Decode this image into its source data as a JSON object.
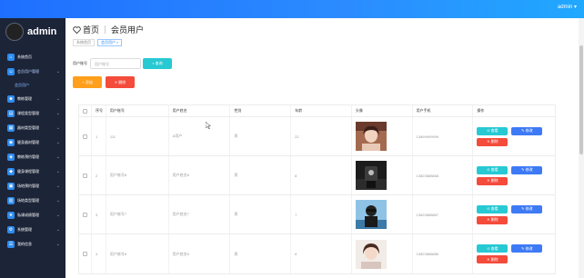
{
  "topbar": {
    "user": "admin ▾"
  },
  "brand": {
    "name": "admin"
  },
  "sidebar": {
    "items": [
      {
        "label": "系统首页",
        "caret": "",
        "icon": "⌂"
      },
      {
        "label": "会员用户管理",
        "caret": "⌄",
        "icon": "☺",
        "active": true
      },
      {
        "label": "会员用户",
        "sub": true
      },
      {
        "label": "教练管理",
        "caret": "⌄",
        "icon": "☻"
      },
      {
        "label": "课程类型管理",
        "caret": "⌄",
        "icon": "▤"
      },
      {
        "label": "器材类型管理",
        "caret": "⌄",
        "icon": "▦"
      },
      {
        "label": "健身器材管理",
        "caret": "⌄",
        "icon": "◉"
      },
      {
        "label": "教练预约管理",
        "caret": "⌄",
        "icon": "◈"
      },
      {
        "label": "健身课程管理",
        "caret": "⌄",
        "icon": "◆"
      },
      {
        "label": "场地预约管理",
        "caret": "⌄",
        "icon": "▣"
      },
      {
        "label": "场地类型管理",
        "caret": "⌄",
        "icon": "▥"
      },
      {
        "label": "私课成绩管理",
        "caret": "⌄",
        "icon": "★"
      },
      {
        "label": "系统管理",
        "caret": "⌄",
        "icon": "⚙"
      },
      {
        "label": "我的信息",
        "caret": "⌄",
        "icon": "☰"
      }
    ]
  },
  "header": {
    "home": "首页",
    "title": "会员用户",
    "home_icon": "heart-icon"
  },
  "tabs": [
    {
      "label": "系统首页"
    },
    {
      "label": "会员用户 ×"
    }
  ],
  "filter": {
    "label": "用户账号",
    "placeholder": "用户账号",
    "search_label": "⌕ 查询"
  },
  "actions": {
    "add_label": "+ 添加",
    "delete_label": "✕ 删除"
  },
  "table": {
    "columns": [
      "",
      "序号",
      "用户账号",
      "用户姓名",
      "性别",
      "年龄",
      "头像",
      "用户手机",
      "操作"
    ],
    "rows": [
      {
        "no": "1",
        "account": "111",
        "name": "A用户",
        "gender": "男",
        "age": "22",
        "phone": "13899999999"
      },
      {
        "no": "2",
        "account": "用户账号8",
        "name": "用户姓名8",
        "gender": "男",
        "age": "8",
        "phone": "13823888888"
      },
      {
        "no": "3",
        "account": "用户账号7",
        "name": "用户姓名7",
        "gender": "男",
        "age": "7",
        "phone": "13823888887"
      },
      {
        "no": "4",
        "account": "用户账号6",
        "name": "用户姓名6",
        "gender": "男",
        "age": "6",
        "phone": "13823888886"
      }
    ],
    "ops": {
      "view": "⊙ 查看",
      "edit": "✎ 修改",
      "delete": "✕ 删除"
    }
  }
}
